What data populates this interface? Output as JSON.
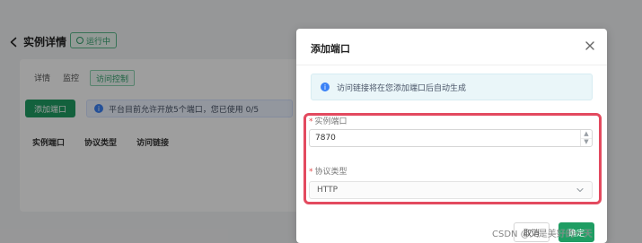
{
  "header": {
    "title": "实例详情",
    "status": "运行中"
  },
  "tabs": [
    {
      "label": "详情"
    },
    {
      "label": "监控"
    },
    {
      "label": "访问控制"
    }
  ],
  "toolbar": {
    "add_port_label": "添加端口",
    "notice": "平台目前允许开放5个端口，您已使用 0/5"
  },
  "table": {
    "columns": [
      "实例端口",
      "协议类型",
      "访问链接"
    ]
  },
  "modal": {
    "title": "添加端口",
    "info": "访问链接将在您添加端口后自动生成",
    "fields": {
      "port_label": "实例端口",
      "port_value": "7870",
      "protocol_label": "协议类型",
      "protocol_value": "HTTP"
    },
    "footer": {
      "cancel_label": "取消",
      "ok_label": "确定"
    }
  },
  "watermark": "CSDN @又是美好的一天",
  "colors": {
    "primary": "#1f9d63",
    "highlight": "#e34a5f",
    "overlay": "rgba(0,0,0,0.38)"
  }
}
